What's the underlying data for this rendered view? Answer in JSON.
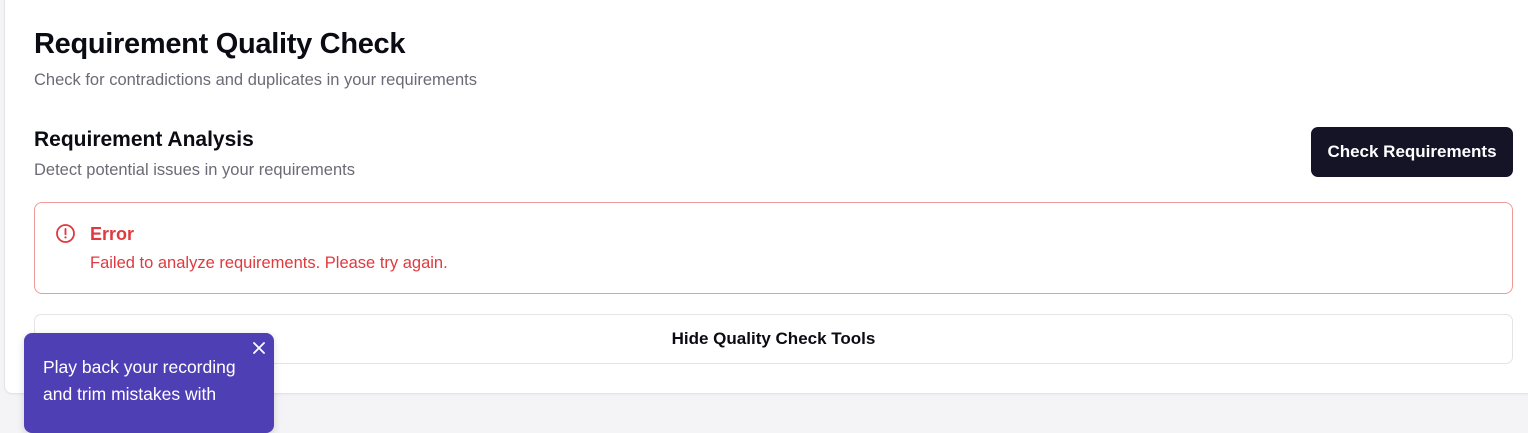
{
  "header": {
    "title": "Requirement Quality Check",
    "subtitle": "Check for contradictions and duplicates in your requirements"
  },
  "analysis": {
    "title": "Requirement Analysis",
    "subtitle": "Detect potential issues in your requirements",
    "check_button_label": "Check Requirements"
  },
  "error": {
    "icon": "alert-circle-icon",
    "title": "Error",
    "message": "Failed to analyze requirements. Please try again."
  },
  "toggle": {
    "label": "Hide Quality Check Tools"
  },
  "promo": {
    "text": "Play back your recording and trim mistakes with",
    "close_icon": "close-icon"
  },
  "colors": {
    "primary_button": "#141426",
    "error": "#e0393e",
    "error_border": "#ef9a9a",
    "promo_background": "#4f3fb4"
  }
}
